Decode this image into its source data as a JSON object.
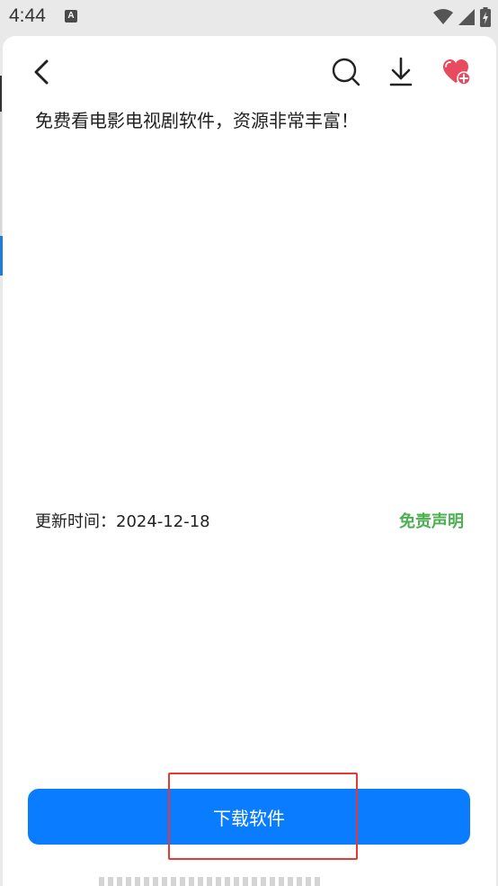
{
  "status_bar": {
    "time": "4:44",
    "notification_icon": "A",
    "icons": [
      "wifi-icon",
      "signal-icon",
      "battery-charging-icon"
    ]
  },
  "toolbar": {
    "icons": [
      "back-chevron-icon",
      "search-icon",
      "download-arrow-icon",
      "heart-plus-icon"
    ]
  },
  "content": {
    "description": "免费看电影电视剧软件，资源非常丰富！",
    "update_time": "更新时间：2024-12-18",
    "disclaimer": "免责声明"
  },
  "actions": {
    "download_button_label": "下载软件"
  },
  "colors": {
    "primary_button": "#0a7cff",
    "disclaimer": "#4caf50",
    "favorite": "#e84a5f",
    "highlight": "#e53935"
  }
}
